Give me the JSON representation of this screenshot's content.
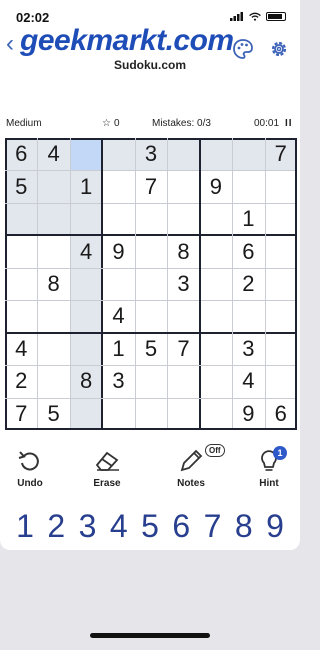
{
  "status": {
    "time": "02:02"
  },
  "header": {
    "brand": "geekmarkt.com",
    "subtitle": "Sudoku.com"
  },
  "info": {
    "difficulty": "Medium",
    "score": "0",
    "mistakes": "Mistakes: 0/3",
    "timer": "00:01"
  },
  "board": {
    "rows": [
      [
        "6",
        "4",
        "",
        "",
        "3",
        "",
        "",
        "",
        "7"
      ],
      [
        "5",
        "",
        "1",
        "",
        "7",
        "",
        "9",
        "",
        ""
      ],
      [
        "",
        "",
        "",
        "",
        "",
        "",
        "",
        "1",
        ""
      ],
      [
        "",
        "",
        "4",
        "9",
        "",
        "8",
        "",
        "6",
        ""
      ],
      [
        "",
        "8",
        "",
        "",
        "",
        "3",
        "",
        "2",
        ""
      ],
      [
        "",
        "",
        "",
        "4",
        "",
        "",
        "",
        "",
        ""
      ],
      [
        "4",
        "",
        "",
        "1",
        "5",
        "7",
        "",
        "3",
        ""
      ],
      [
        "2",
        "",
        "8",
        "3",
        "",
        "",
        "",
        "4",
        ""
      ],
      [
        "7",
        "5",
        "",
        "",
        "",
        "",
        "",
        "9",
        "6"
      ]
    ],
    "selected": [
      0,
      2
    ],
    "colors": {
      "selected": "#c3d7f7",
      "highlight": "#e2e6ed",
      "white": "#ffffff"
    }
  },
  "actions": [
    {
      "id": "undo",
      "label": "Undo"
    },
    {
      "id": "erase",
      "label": "Erase"
    },
    {
      "id": "notes",
      "label": "Notes",
      "badge": "Off"
    },
    {
      "id": "hint",
      "label": "Hint",
      "badge": "1"
    }
  ],
  "numpad": [
    "1",
    "2",
    "3",
    "4",
    "5",
    "6",
    "7",
    "8",
    "9"
  ]
}
